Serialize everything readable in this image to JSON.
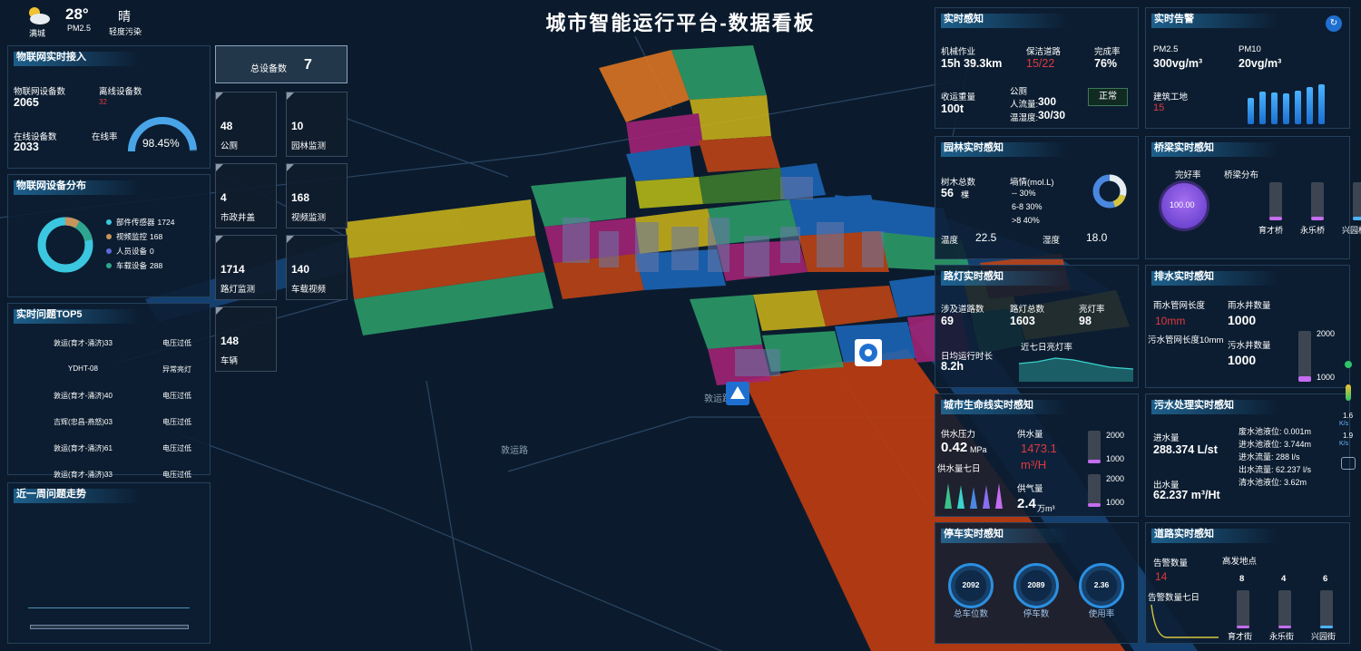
{
  "page": {
    "title": "城市智能运行平台-数据看板"
  },
  "weather": {
    "temp": "28°",
    "city": "满城",
    "pm": "PM2.5",
    "condition": "晴",
    "pollution": "轻度污染"
  },
  "iot_access": {
    "title": "物联网实时接入",
    "online_total_label": "物联网设备数",
    "online_total": "2065",
    "offline_label": "离线设备数",
    "offline": "32",
    "online_label": "在线设备数",
    "online": "2033",
    "rate_label": "在线率",
    "rate": "98.45%",
    "rate_value": 98.45
  },
  "device_tiles": {
    "total_label": "总设备数",
    "total": "7",
    "items": [
      {
        "value": "48",
        "label": "公厕"
      },
      {
        "value": "10",
        "label": "园林监测"
      },
      {
        "value": "4",
        "label": "市政井盖"
      },
      {
        "value": "168",
        "label": "视频监测"
      },
      {
        "value": "1714",
        "label": "路灯监测"
      },
      {
        "value": "140",
        "label": "车载视频"
      },
      {
        "value": "148",
        "label": "车辆"
      }
    ]
  },
  "device_dist": {
    "title": "物联网设备分布",
    "legend": [
      {
        "label": "部件传感器",
        "value": "1724",
        "color": "#3cc7e0"
      },
      {
        "label": "视频监控",
        "value": "168",
        "color": "#c7945a"
      },
      {
        "label": "人员设备",
        "value": "0",
        "color": "#5d6bd8"
      },
      {
        "label": "车载设备",
        "value": "288",
        "color": "#2fa58f"
      }
    ]
  },
  "top5": {
    "title": "实时问题TOP5",
    "rows": [
      {
        "name": "敦运(育才-涌济)33",
        "issue": "电压过低"
      },
      {
        "name": "YDHT-08",
        "issue": "异常亮灯"
      },
      {
        "name": "敦运(育才-涌济)40",
        "issue": "电压过低"
      },
      {
        "name": "吉辉(忠昌-燕怒)03",
        "issue": "电压过低"
      },
      {
        "name": "敦运(育才-涌济)61",
        "issue": "电压过低"
      },
      {
        "name": "敦运(育才-涌济)33",
        "issue": "电压过低"
      }
    ]
  },
  "week_trend": {
    "title": "近一周问题走势"
  },
  "realtime_sense": {
    "title": "实时感知",
    "machine_label": "机械作业",
    "machine": "15h 39.3km",
    "roads_label": "保洁道路",
    "roads": "15/22",
    "done_label": "完成率",
    "done": "76%",
    "collect_label": "收运重量",
    "collect": "100t",
    "toilet_label": "公厕",
    "flow_label": "人流量:",
    "flow": "300",
    "temp_label": "温湿度:",
    "temp": "30/30",
    "status": "正常"
  },
  "alarm": {
    "title": "实时告警",
    "pm25_label": "PM2.5",
    "pm25": "300vg/m³",
    "pm10_label": "PM10",
    "pm10": "20vg/m³",
    "site_label": "建筑工地",
    "site": "15",
    "bars": [
      0.55,
      0.7,
      0.68,
      0.66,
      0.72,
      0.78,
      0.85
    ]
  },
  "garden": {
    "title": "园林实时感知",
    "trees_label": "树木总数",
    "trees": "56",
    "trees_unit": "棵",
    "soil_label": "墒情(mol.L)",
    "soil": [
      "-- 30%",
      "6-8 30%",
      ">8 40%"
    ],
    "temp_label": "温度",
    "temp": "22.5",
    "humid_label": "湿度",
    "humid": "18.0"
  },
  "bridge": {
    "title": "桥梁实时感知",
    "rate_label": "完好率",
    "rate": "100.00",
    "rate_value": 100,
    "dist_label": "桥梁分布",
    "bars": [
      {
        "label": "育才桥",
        "value": 0.1
      },
      {
        "label": "永乐桥",
        "value": 0.1
      },
      {
        "label": "兴园桥",
        "value": 0.1
      }
    ]
  },
  "lamp": {
    "title": "路灯实时感知",
    "roads_label": "涉及道路数",
    "roads": "69",
    "total_label": "路灯总数",
    "total": "1603",
    "rate_label": "亮灯率",
    "rate": "98",
    "avg_label": "日均运行时长",
    "avg": "8.2h",
    "week_label": "近七日亮灯率"
  },
  "drain": {
    "title": "排水实时感知",
    "pipe_label": "雨水管网长度",
    "pipe": "10mm",
    "well_label": "雨水井数量",
    "well": "1000",
    "sewer_label": "污水管网长度10mm",
    "swell_label": "污水井数量",
    "swell": "1000",
    "axis_top": "2000",
    "axis_bot": "1000"
  },
  "lifeline": {
    "title": "城市生命线实时感知",
    "pressure_label": "供水压力",
    "pressure": "0.42",
    "pressure_unit": "MPa",
    "supply_label": "供水量",
    "supply": "1473.1",
    "supply_unit": "m³/H",
    "week_label": "供水量七日",
    "gas_label": "供气量",
    "gas": "2.4",
    "gas_unit": "万m³",
    "axis_top": "2000",
    "axis_bot": "1000",
    "axis_top2": "2000",
    "axis_bot2": "1000"
  },
  "sewage": {
    "title": "污水处理实时感知",
    "in_label": "进水量",
    "in": "288.374 L/st",
    "out_label": "出水量",
    "out": "62.237 m³/Ht",
    "details": [
      "废水池液位: 0.001m",
      "进水池液位: 3.744m",
      "进水流量: 288 l/s",
      "出水流量: 62.237 l/s",
      "清水池液位: 3.62m"
    ]
  },
  "parking": {
    "title": "停车实时感知",
    "gauges": [
      {
        "value": "2092",
        "label": "总车位数"
      },
      {
        "value": "2089",
        "label": "停车数"
      },
      {
        "value": "2.36",
        "label": "使用率"
      }
    ]
  },
  "road": {
    "title": "道路实时感知",
    "alarm_label": "告警数量",
    "alarm": "14",
    "week_label": "告警数量七日",
    "hot_label": "高发地点",
    "bars": [
      {
        "label": "育才街",
        "value": "8",
        "ratio": 0.08
      },
      {
        "label": "永乐街",
        "value": "4",
        "ratio": 0.08
      },
      {
        "label": "兴园街",
        "value": "6",
        "ratio": 0.08
      }
    ]
  },
  "side_tools": {
    "speed_up": "1.6",
    "speed_down": "1.9",
    "unit": "K/s"
  },
  "map_labels": {
    "road1": "敦运路",
    "road2": "敦运路"
  }
}
